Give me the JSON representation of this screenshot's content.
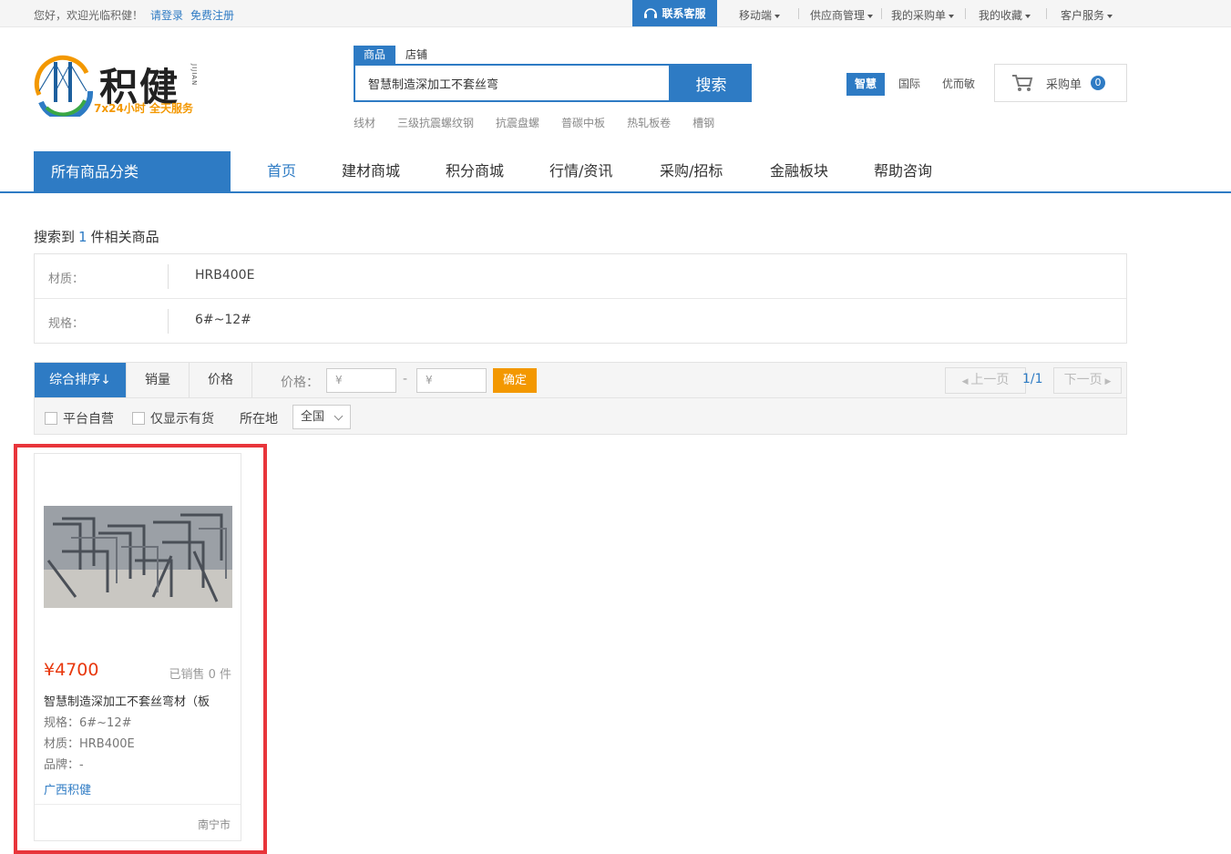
{
  "topbar": {
    "greeting": "您好，欢迎光临积健！",
    "login": "请登录",
    "register": "免费注册",
    "service": "联系客服",
    "menus": [
      "移动端",
      "供应商管理",
      "我的采购单",
      "我的收藏",
      "客户服务"
    ]
  },
  "logo": {
    "name": "积健",
    "pinyin": "JIJIAN",
    "slogan": "7x24小时  全天服务"
  },
  "search": {
    "tabs": [
      "商品",
      "店铺"
    ],
    "value": "智慧制造深加工不套丝弯",
    "button": "搜索",
    "hot_words": [
      "线材",
      "三级抗震螺纹钢",
      "抗震盘螺",
      "普碳中板",
      "热轧板卷",
      "槽钢"
    ]
  },
  "site_tabs": [
    "智慧",
    "国际",
    "优而敏"
  ],
  "cart": {
    "label": "采购单",
    "count": "0"
  },
  "nav": {
    "all_categories": "所有商品分类",
    "items": [
      "首页",
      "建材商城",
      "积分商城",
      "行情/资讯",
      "采购/招标",
      "金融板块",
      "帮助咨询"
    ]
  },
  "result": {
    "prefix": "搜索到",
    "count": "1",
    "suffix": "件相关商品"
  },
  "filters": [
    {
      "label": "材质：",
      "value": "HRB400E"
    },
    {
      "label": "规格：",
      "value": "6#~12#"
    }
  ],
  "sort": {
    "options": [
      "综合排序↓",
      "销量",
      "价格"
    ],
    "price_label": "价格：",
    "price_min_placeholder": "¥",
    "price_max_placeholder": "¥",
    "price_dash": "-",
    "confirm": "确定",
    "prev": "上一页",
    "page_info": "1/1",
    "next": "下一页"
  },
  "options": {
    "self_operated": "平台自营",
    "in_stock": "仅显示有货",
    "location_label": "所在地",
    "location_value": "全国"
  },
  "product": {
    "price": "¥4700",
    "sold": "已销售 0 件",
    "title": "智慧制造深加工不套丝弯材（板",
    "spec": "规格：6#~12#",
    "material": "材质：HRB400E",
    "brand": "品牌：-",
    "shop": "广西积健",
    "city": "南宁市"
  },
  "colors": {
    "brand_blue": "#2e7bc4",
    "price_red": "#e8380d",
    "accent_orange": "#f39800",
    "highlight_red": "#e8353b"
  }
}
